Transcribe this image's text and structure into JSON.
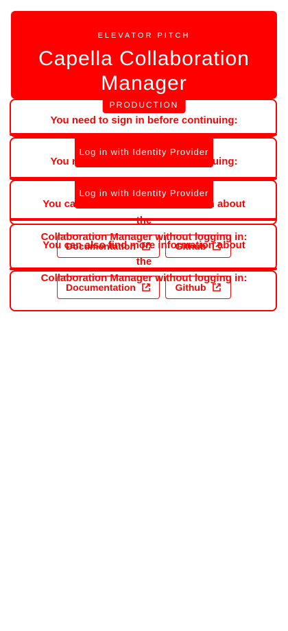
{
  "header": {
    "eyebrow": "ELEVATOR PITCH",
    "title_line1": "Capella Collaboration",
    "title_line2": "Manager",
    "environment": "PRODUCTION"
  },
  "login": {
    "prompt": "You need to sign in before continuing:",
    "button_label": "Log in with Identity Provider"
  },
  "info": {
    "line1": "You can also find more information about the",
    "line2": "Collaboration Manager without logging in:"
  },
  "links": {
    "documentation": "Documentation",
    "github": "Github"
  },
  "colors": {
    "accent": "#ff0000",
    "background": "#ffffff"
  }
}
